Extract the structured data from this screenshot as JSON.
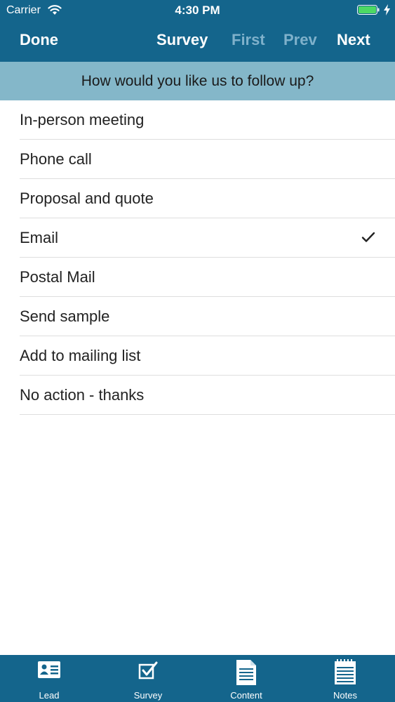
{
  "status_bar": {
    "carrier": "Carrier",
    "time": "4:30 PM",
    "wifi_icon": "wifi-icon",
    "battery_icon": "battery-icon",
    "battery_color": "#4cd964"
  },
  "nav": {
    "done": "Done",
    "survey": "Survey",
    "first": "First",
    "prev": "Prev",
    "next": "Next"
  },
  "question": "How would you like us to follow up?",
  "options": [
    {
      "label": "In-person meeting",
      "selected": false
    },
    {
      "label": "Phone call",
      "selected": false
    },
    {
      "label": "Proposal and quote",
      "selected": false
    },
    {
      "label": "Email",
      "selected": true
    },
    {
      "label": "Postal Mail",
      "selected": false
    },
    {
      "label": "Send sample",
      "selected": false
    },
    {
      "label": "Add to mailing list",
      "selected": false
    },
    {
      "label": "No action - thanks",
      "selected": false
    }
  ],
  "tabs": [
    {
      "label": "Lead",
      "icon": "id-card-icon"
    },
    {
      "label": "Survey",
      "icon": "checkbox-icon"
    },
    {
      "label": "Content",
      "icon": "document-icon"
    },
    {
      "label": "Notes",
      "icon": "notepad-icon"
    }
  ],
  "colors": {
    "nav_background": "#14658c",
    "question_background": "#84b7c9",
    "disabled_nav": "#7fb1cb"
  }
}
